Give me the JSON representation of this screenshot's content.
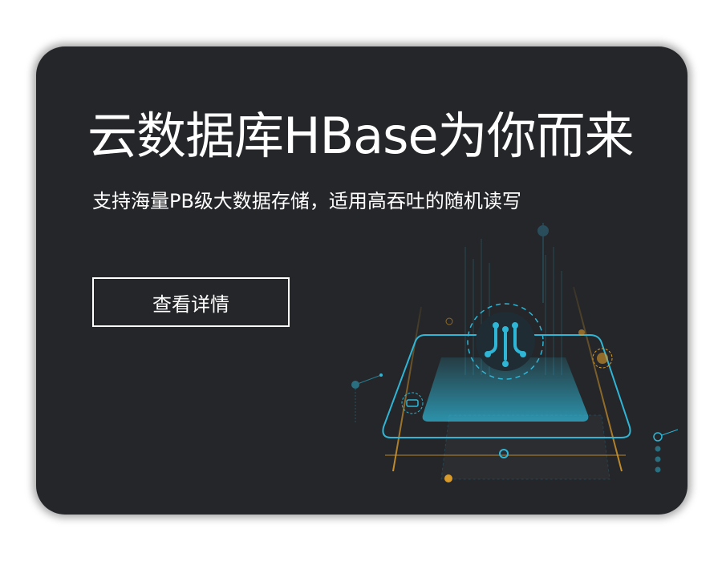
{
  "banner": {
    "title": "云数据库HBase为你而来",
    "subtitle": "支持海量PB级大数据存储，适用高吞吐的随机读写",
    "cta_label": "查看详情"
  },
  "colors": {
    "background": "#242629",
    "accent_cyan": "#2fb6d6",
    "accent_orange": "#d89a2b",
    "text": "#ffffff"
  },
  "icons": {
    "center_icon": "database-circuit-icon",
    "link_icon": "link-icon",
    "help_icon": "question-icon"
  }
}
